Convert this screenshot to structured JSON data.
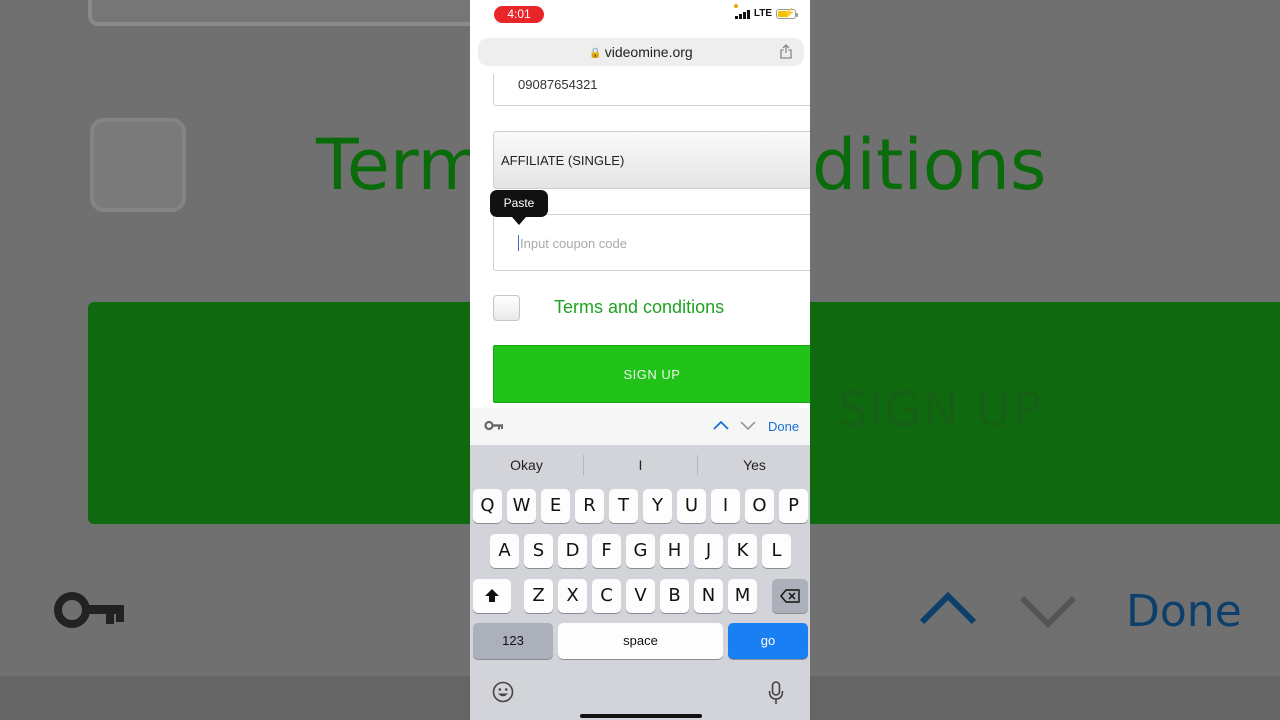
{
  "background": {
    "terms_left": "Term",
    "terms_right": "ditions",
    "signup": "SIGN UP",
    "done": "Done"
  },
  "status_bar": {
    "time": "4:01",
    "network": "LTE"
  },
  "browser": {
    "url": "videomine.org"
  },
  "form": {
    "phone_value": "09087654321",
    "package_selected": "AFFILIATE (SINGLE)",
    "coupon_placeholder": "Input coupon code",
    "terms_label": "Terms and conditions",
    "signup_label": "SIGN UP"
  },
  "context_menu": {
    "paste_label": "Paste"
  },
  "accessory_bar": {
    "done_label": "Done"
  },
  "keyboard": {
    "suggestions": [
      "Okay",
      "I",
      "Yes"
    ],
    "row1": [
      "Q",
      "W",
      "E",
      "R",
      "T",
      "Y",
      "U",
      "I",
      "O",
      "P"
    ],
    "row2": [
      "A",
      "S",
      "D",
      "F",
      "G",
      "H",
      "J",
      "K",
      "L"
    ],
    "row3": [
      "Z",
      "X",
      "C",
      "V",
      "B",
      "N",
      "M"
    ],
    "numbers_label": "123",
    "space_label": "space",
    "go_label": "go"
  },
  "colors": {
    "accent_green": "#22c318",
    "link_blue": "#1a6fd6",
    "time_pill": "#e8262a"
  }
}
